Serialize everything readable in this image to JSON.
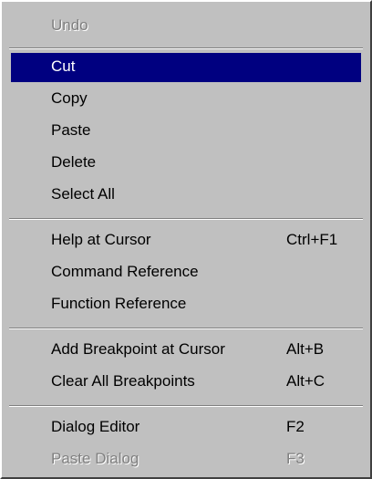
{
  "menu": {
    "undo": "Undo",
    "cut": "Cut",
    "copy": "Copy",
    "paste": "Paste",
    "delete": "Delete",
    "select_all": "Select All",
    "help_at_cursor": "Help at Cursor",
    "help_at_cursor_shortcut": "Ctrl+F1",
    "command_reference": "Command Reference",
    "function_reference": "Function Reference",
    "add_breakpoint": "Add Breakpoint at Cursor",
    "add_breakpoint_shortcut": "Alt+B",
    "clear_breakpoints": "Clear All Breakpoints",
    "clear_breakpoints_shortcut": "Alt+C",
    "dialog_editor": "Dialog Editor",
    "dialog_editor_shortcut": "F2",
    "paste_dialog": "Paste Dialog",
    "paste_dialog_shortcut": "F3"
  },
  "colors": {
    "menu_bg": "#c0c0c0",
    "highlight_bg": "#000080",
    "highlight_text": "#ffffff",
    "disabled_text": "#808080"
  }
}
